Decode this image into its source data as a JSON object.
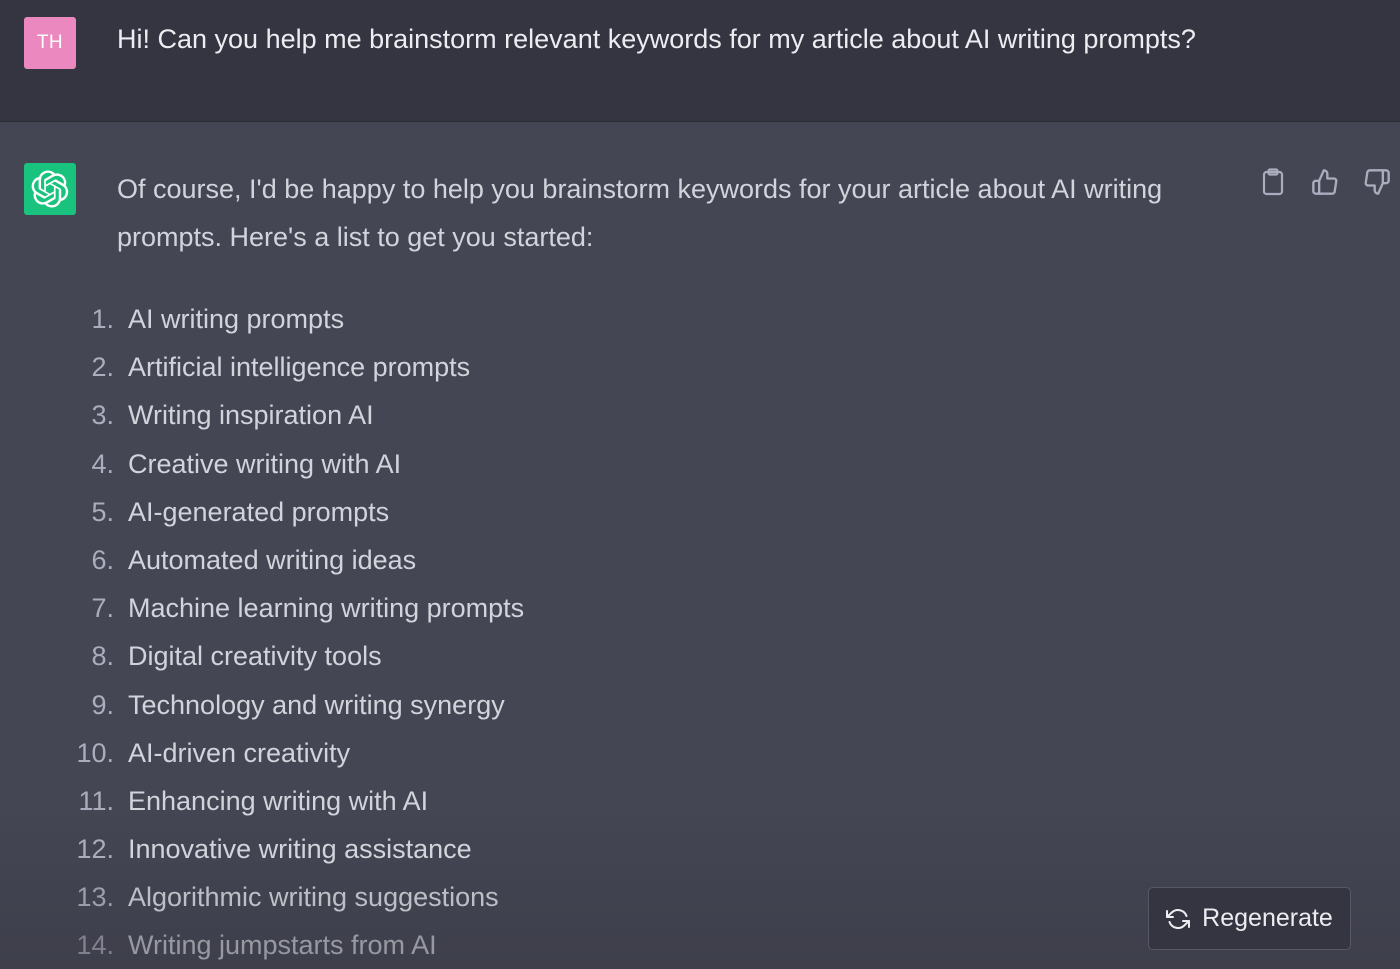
{
  "user_message": {
    "avatar_initials": "TH",
    "avatar_color": "#ea88bf",
    "text": "Hi! Can you help me brainstorm relevant keywords for my article about AI writing prompts?"
  },
  "assistant_message": {
    "avatar_icon": "openai-logo-icon",
    "avatar_color": "#19c37d",
    "intro": "Of course, I'd be happy to help you brainstorm keywords for your article about AI writing prompts. Here's a list to get you started:",
    "actions": [
      {
        "name": "copy",
        "icon": "clipboard-icon"
      },
      {
        "name": "thumbs-up",
        "icon": "thumbs-up-icon"
      },
      {
        "name": "thumbs-down",
        "icon": "thumbs-down-icon"
      }
    ],
    "keywords": [
      {
        "num": "1.",
        "text": "AI writing prompts"
      },
      {
        "num": "2.",
        "text": "Artificial intelligence prompts"
      },
      {
        "num": "3.",
        "text": "Writing inspiration AI"
      },
      {
        "num": "4.",
        "text": "Creative writing with AI"
      },
      {
        "num": "5.",
        "text": "AI-generated prompts"
      },
      {
        "num": "6.",
        "text": "Automated writing ideas"
      },
      {
        "num": "7.",
        "text": "Machine learning writing prompts"
      },
      {
        "num": "8.",
        "text": "Digital creativity tools"
      },
      {
        "num": "9.",
        "text": "Technology and writing synergy"
      },
      {
        "num": "10.",
        "text": "AI-driven creativity"
      },
      {
        "num": "11.",
        "text": "Enhancing writing with AI"
      },
      {
        "num": "12.",
        "text": "Innovative writing assistance"
      },
      {
        "num": "13.",
        "text": "Algorithmic writing suggestions"
      },
      {
        "num": "14.",
        "text": "Writing jumpstarts from AI"
      }
    ]
  },
  "regenerate_button": {
    "label": "Regenerate",
    "icon": "refresh-icon"
  },
  "colors": {
    "user_bg": "#343541",
    "assistant_bg": "#444654",
    "text_primary": "#ececf1",
    "text_secondary": "#d1d5db"
  }
}
